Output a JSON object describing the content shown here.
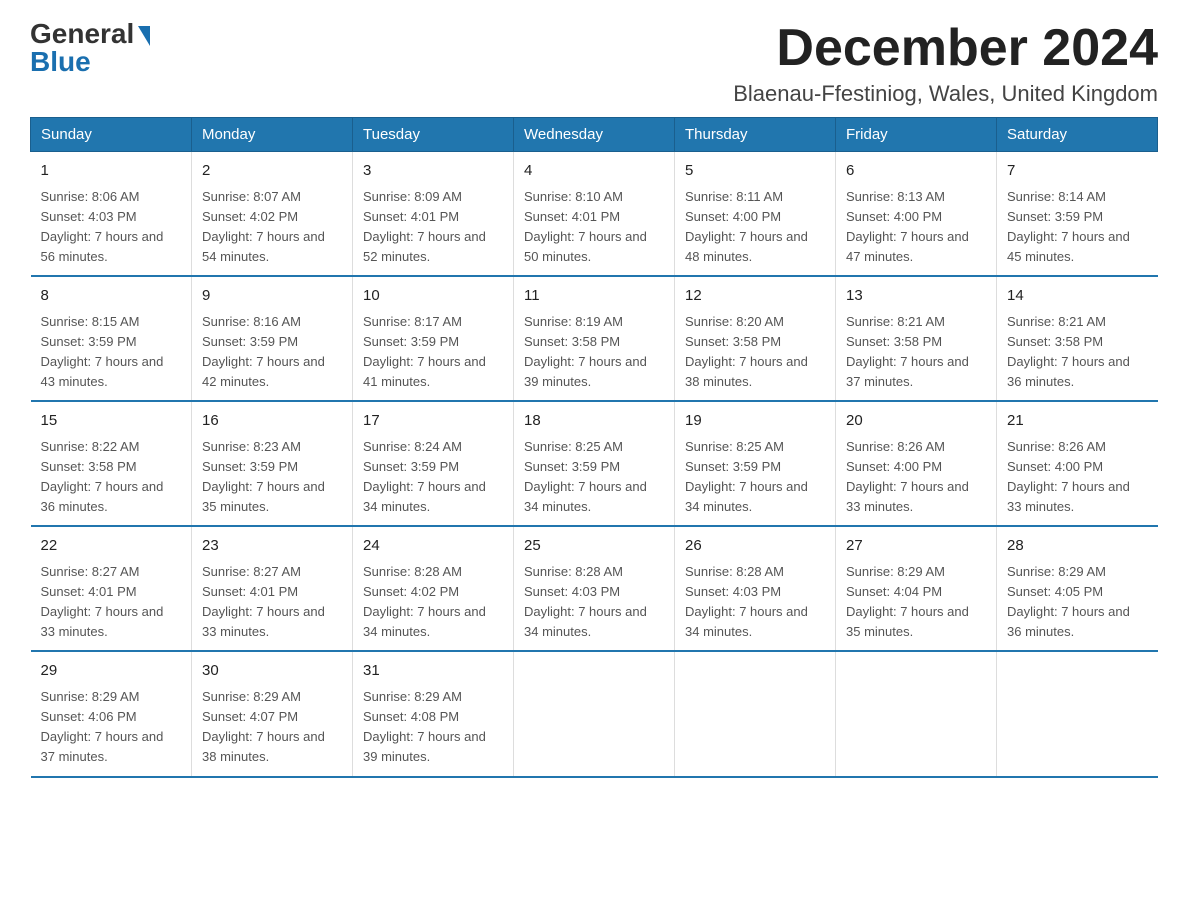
{
  "logo": {
    "general": "General",
    "blue": "Blue"
  },
  "title": {
    "month_year": "December 2024",
    "location": "Blaenau-Ffestiniog, Wales, United Kingdom"
  },
  "headers": [
    "Sunday",
    "Monday",
    "Tuesday",
    "Wednesday",
    "Thursday",
    "Friday",
    "Saturday"
  ],
  "weeks": [
    [
      {
        "day": "1",
        "sunrise": "8:06 AM",
        "sunset": "4:03 PM",
        "daylight": "7 hours and 56 minutes."
      },
      {
        "day": "2",
        "sunrise": "8:07 AM",
        "sunset": "4:02 PM",
        "daylight": "7 hours and 54 minutes."
      },
      {
        "day": "3",
        "sunrise": "8:09 AM",
        "sunset": "4:01 PM",
        "daylight": "7 hours and 52 minutes."
      },
      {
        "day": "4",
        "sunrise": "8:10 AM",
        "sunset": "4:01 PM",
        "daylight": "7 hours and 50 minutes."
      },
      {
        "day": "5",
        "sunrise": "8:11 AM",
        "sunset": "4:00 PM",
        "daylight": "7 hours and 48 minutes."
      },
      {
        "day": "6",
        "sunrise": "8:13 AM",
        "sunset": "4:00 PM",
        "daylight": "7 hours and 47 minutes."
      },
      {
        "day": "7",
        "sunrise": "8:14 AM",
        "sunset": "3:59 PM",
        "daylight": "7 hours and 45 minutes."
      }
    ],
    [
      {
        "day": "8",
        "sunrise": "8:15 AM",
        "sunset": "3:59 PM",
        "daylight": "7 hours and 43 minutes."
      },
      {
        "day": "9",
        "sunrise": "8:16 AM",
        "sunset": "3:59 PM",
        "daylight": "7 hours and 42 minutes."
      },
      {
        "day": "10",
        "sunrise": "8:17 AM",
        "sunset": "3:59 PM",
        "daylight": "7 hours and 41 minutes."
      },
      {
        "day": "11",
        "sunrise": "8:19 AM",
        "sunset": "3:58 PM",
        "daylight": "7 hours and 39 minutes."
      },
      {
        "day": "12",
        "sunrise": "8:20 AM",
        "sunset": "3:58 PM",
        "daylight": "7 hours and 38 minutes."
      },
      {
        "day": "13",
        "sunrise": "8:21 AM",
        "sunset": "3:58 PM",
        "daylight": "7 hours and 37 minutes."
      },
      {
        "day": "14",
        "sunrise": "8:21 AM",
        "sunset": "3:58 PM",
        "daylight": "7 hours and 36 minutes."
      }
    ],
    [
      {
        "day": "15",
        "sunrise": "8:22 AM",
        "sunset": "3:58 PM",
        "daylight": "7 hours and 36 minutes."
      },
      {
        "day": "16",
        "sunrise": "8:23 AM",
        "sunset": "3:59 PM",
        "daylight": "7 hours and 35 minutes."
      },
      {
        "day": "17",
        "sunrise": "8:24 AM",
        "sunset": "3:59 PM",
        "daylight": "7 hours and 34 minutes."
      },
      {
        "day": "18",
        "sunrise": "8:25 AM",
        "sunset": "3:59 PM",
        "daylight": "7 hours and 34 minutes."
      },
      {
        "day": "19",
        "sunrise": "8:25 AM",
        "sunset": "3:59 PM",
        "daylight": "7 hours and 34 minutes."
      },
      {
        "day": "20",
        "sunrise": "8:26 AM",
        "sunset": "4:00 PM",
        "daylight": "7 hours and 33 minutes."
      },
      {
        "day": "21",
        "sunrise": "8:26 AM",
        "sunset": "4:00 PM",
        "daylight": "7 hours and 33 minutes."
      }
    ],
    [
      {
        "day": "22",
        "sunrise": "8:27 AM",
        "sunset": "4:01 PM",
        "daylight": "7 hours and 33 minutes."
      },
      {
        "day": "23",
        "sunrise": "8:27 AM",
        "sunset": "4:01 PM",
        "daylight": "7 hours and 33 minutes."
      },
      {
        "day": "24",
        "sunrise": "8:28 AM",
        "sunset": "4:02 PM",
        "daylight": "7 hours and 34 minutes."
      },
      {
        "day": "25",
        "sunrise": "8:28 AM",
        "sunset": "4:03 PM",
        "daylight": "7 hours and 34 minutes."
      },
      {
        "day": "26",
        "sunrise": "8:28 AM",
        "sunset": "4:03 PM",
        "daylight": "7 hours and 34 minutes."
      },
      {
        "day": "27",
        "sunrise": "8:29 AM",
        "sunset": "4:04 PM",
        "daylight": "7 hours and 35 minutes."
      },
      {
        "day": "28",
        "sunrise": "8:29 AM",
        "sunset": "4:05 PM",
        "daylight": "7 hours and 36 minutes."
      }
    ],
    [
      {
        "day": "29",
        "sunrise": "8:29 AM",
        "sunset": "4:06 PM",
        "daylight": "7 hours and 37 minutes."
      },
      {
        "day": "30",
        "sunrise": "8:29 AM",
        "sunset": "4:07 PM",
        "daylight": "7 hours and 38 minutes."
      },
      {
        "day": "31",
        "sunrise": "8:29 AM",
        "sunset": "4:08 PM",
        "daylight": "7 hours and 39 minutes."
      },
      null,
      null,
      null,
      null
    ]
  ]
}
